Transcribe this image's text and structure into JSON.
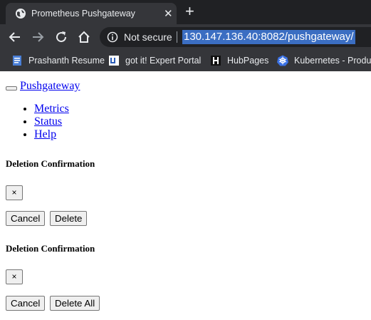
{
  "browser": {
    "tab": {
      "title": "Prometheus Pushgateway",
      "close_glyph": "✕"
    },
    "new_tab_glyph": "+",
    "security_label": "Not secure",
    "url": "130.147.136.40:8082/pushgateway/",
    "bookmarks": [
      {
        "label": "Prashanth Resume",
        "icon": "document-icon"
      },
      {
        "label": "got it! Expert Portal",
        "icon": "gotit-icon"
      },
      {
        "label": "HubPages",
        "icon": "hubpages-icon"
      },
      {
        "label": "Kubernetes - Produ...",
        "icon": "kubernetes-icon"
      }
    ],
    "colors": {
      "tabstrip": "#202124",
      "toolbar": "#35363a",
      "url_highlight": "#3b6ec2"
    }
  },
  "page": {
    "brand": "Pushgateway",
    "nav_items": [
      "Metrics",
      "Status",
      "Help"
    ],
    "modals": [
      {
        "title": "Deletion Confirmation",
        "close_label": "×",
        "cancel_label": "Cancel",
        "confirm_label": "Delete"
      },
      {
        "title": "Deletion Confirmation",
        "close_label": "×",
        "cancel_label": "Cancel",
        "confirm_label": "Delete All"
      }
    ],
    "colors": {
      "link": "#0000ee",
      "button_bg": "#efefef",
      "button_border": "#767676"
    }
  }
}
